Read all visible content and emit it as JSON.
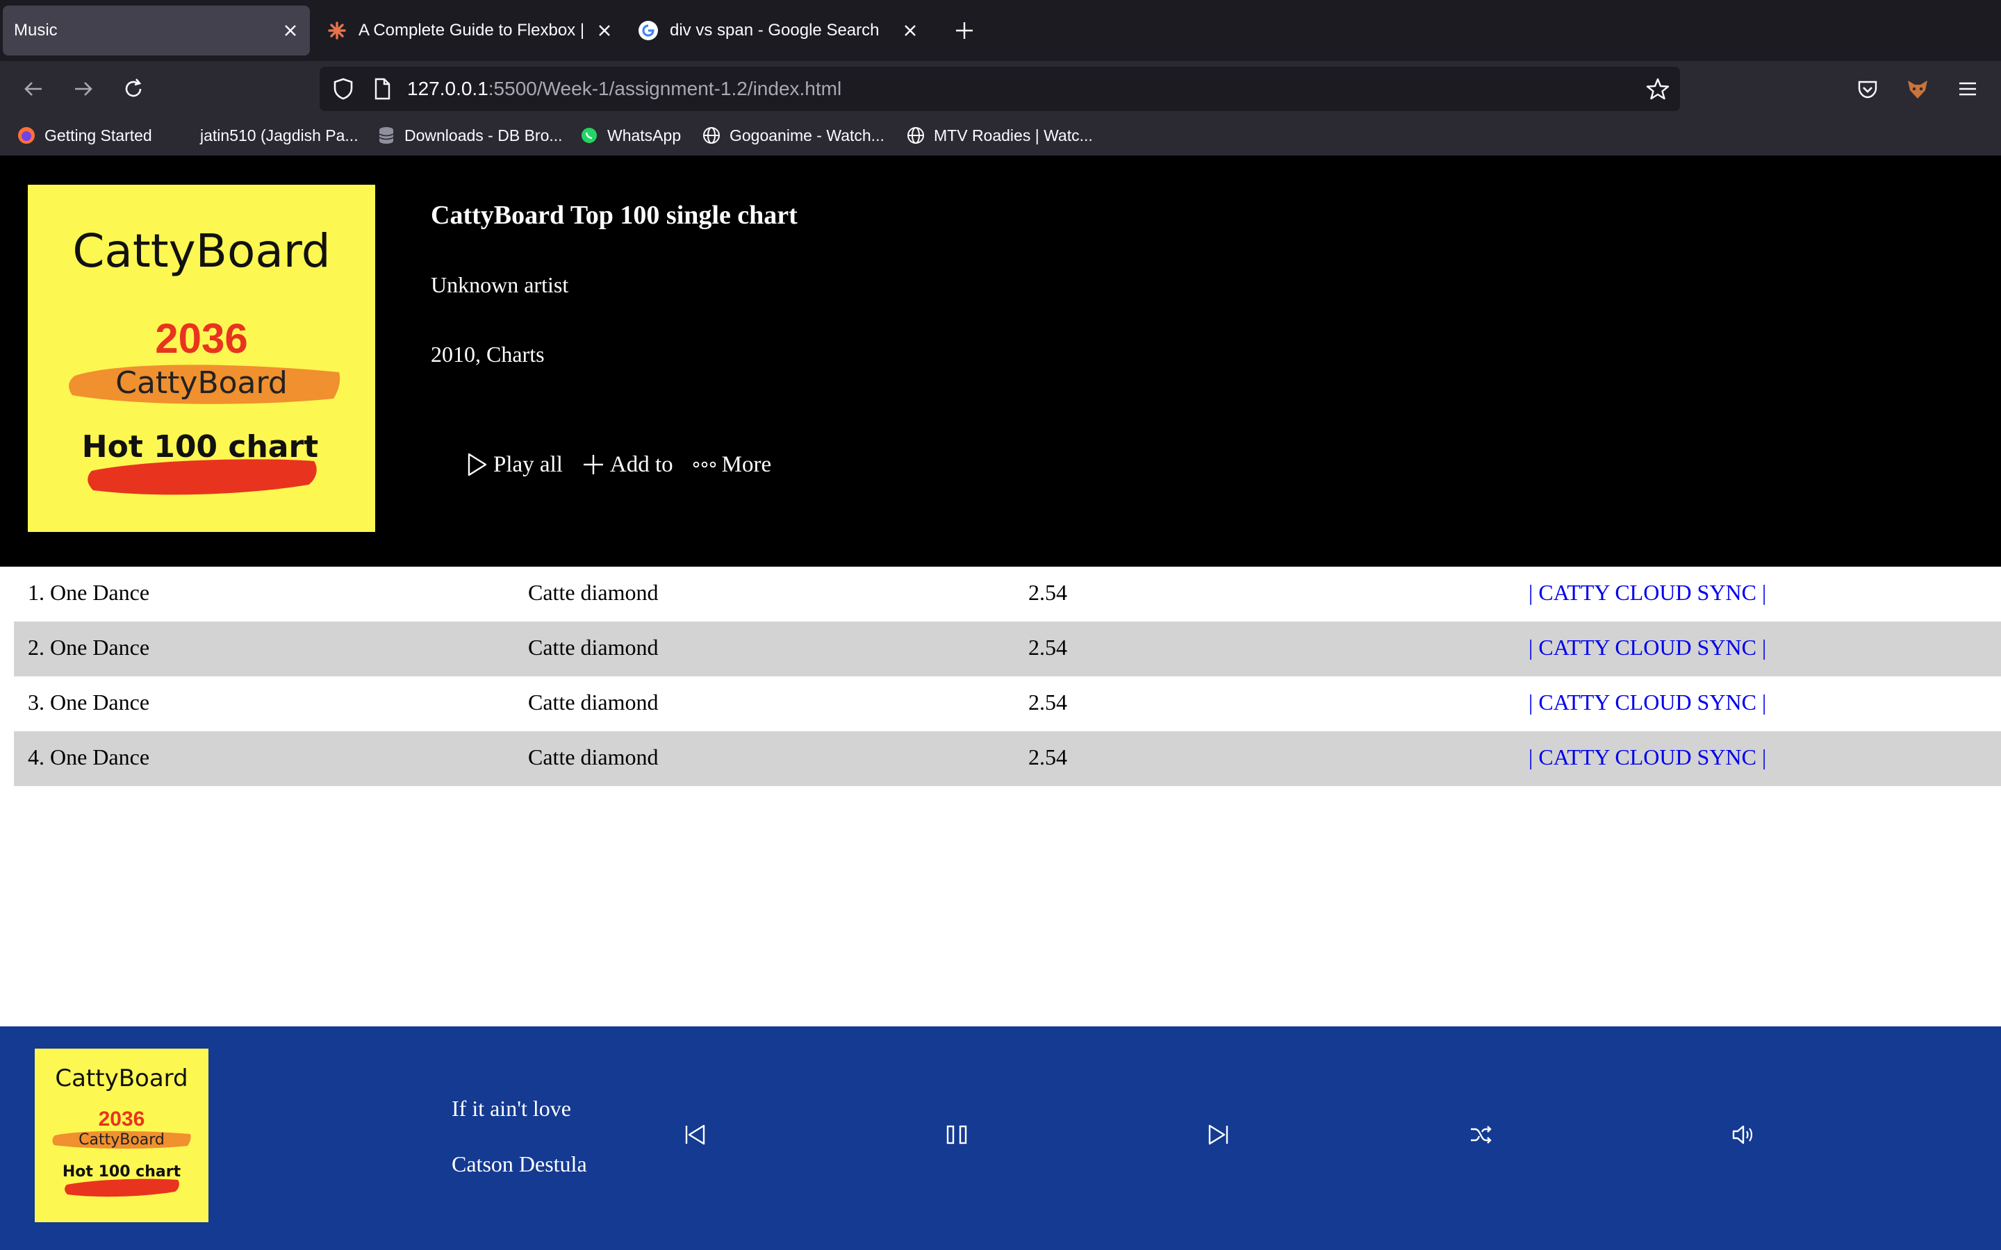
{
  "browser": {
    "tabs": [
      {
        "title": "Music",
        "active": true
      },
      {
        "title": "A Complete Guide to Flexbox | CSS-Tricks",
        "active": false
      },
      {
        "title": "div vs span - Google Search",
        "active": false
      }
    ],
    "url": {
      "host": "127.0.0.1",
      "rest": ":5500/Week-1/assignment-1.2/index.html"
    },
    "bookmarks": [
      {
        "label": "Getting Started",
        "icon": "firefox-icon"
      },
      {
        "label": "jatin510 (Jagdish Pa...",
        "icon": "github-icon"
      },
      {
        "label": "Downloads - DB Bro...",
        "icon": "database-icon"
      },
      {
        "label": "WhatsApp",
        "icon": "whatsapp-icon"
      },
      {
        "label": "Gogoanime - Watch...",
        "icon": "globe-icon"
      },
      {
        "label": "MTV Roadies | Watc...",
        "icon": "globe-icon"
      }
    ]
  },
  "album": {
    "title": "CattyBoard Top 100 single chart",
    "artist": "Unknown artist",
    "meta": "2010, Charts",
    "cover": {
      "brand": "CattyBoard",
      "year": "2036",
      "sub": "CattyBoard",
      "tagline": "Hot 100 chart",
      "colors": {
        "background": "#fdf751",
        "red": "#e8341f",
        "orange": "#f0902f"
      }
    },
    "actions": {
      "play_all": "Play all",
      "add_to": "Add to",
      "more": "More"
    }
  },
  "tracks": [
    {
      "title": "1. One Dance",
      "artist": "Catte diamond",
      "duration": "2.54",
      "link": "| CATTY CLOUD SYNC |"
    },
    {
      "title": "2. One Dance",
      "artist": "Catte diamond",
      "duration": "2.54",
      "link": "| CATTY CLOUD SYNC |"
    },
    {
      "title": "3. One Dance",
      "artist": "Catte diamond",
      "duration": "2.54",
      "link": "| CATTY CLOUD SYNC |"
    },
    {
      "title": "4. One Dance",
      "artist": "Catte diamond",
      "duration": "2.54",
      "link": "| CATTY CLOUD SYNC |"
    }
  ],
  "player": {
    "now_playing_title": "If it ain't love",
    "now_playing_artist": "Catson Destula",
    "background": "#143a91",
    "controls": [
      "previous-icon",
      "pause-icon",
      "next-icon",
      "shuffle-icon",
      "volume-icon"
    ]
  }
}
